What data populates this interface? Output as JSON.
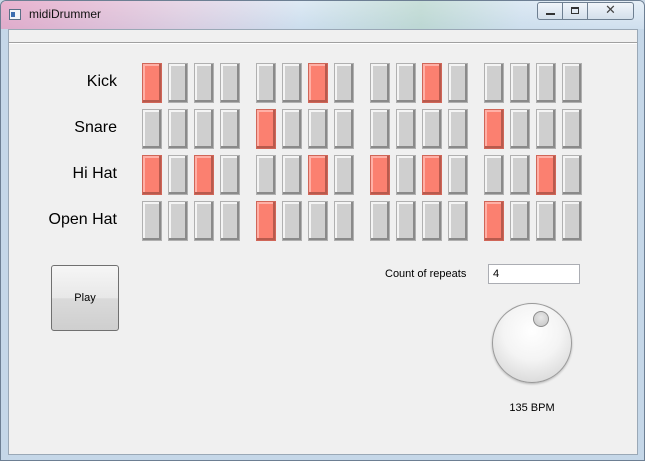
{
  "window": {
    "title": "midiDrummer"
  },
  "tracks": [
    {
      "name": "Kick",
      "steps": [
        1,
        0,
        0,
        0,
        0,
        0,
        1,
        0,
        0,
        0,
        1,
        0,
        0,
        0,
        0,
        0
      ]
    },
    {
      "name": "Snare",
      "steps": [
        0,
        0,
        0,
        0,
        1,
        0,
        0,
        0,
        0,
        0,
        0,
        0,
        1,
        0,
        0,
        0
      ]
    },
    {
      "name": "Hi Hat",
      "steps": [
        1,
        0,
        1,
        0,
        0,
        0,
        1,
        0,
        1,
        0,
        1,
        0,
        0,
        0,
        1,
        0
      ]
    },
    {
      "name": "Open Hat",
      "steps": [
        0,
        0,
        0,
        0,
        1,
        0,
        0,
        0,
        0,
        0,
        0,
        0,
        1,
        0,
        0,
        0
      ]
    }
  ],
  "controls": {
    "play_label": "Play",
    "repeats_label": "Count of repeats",
    "repeats_value": "4",
    "tempo_bpm": 135,
    "tempo_label": "135 BPM"
  },
  "colors": {
    "step_on": "#fb8070",
    "step_off": "#cfcfcf",
    "background": "#f0f0f0"
  }
}
